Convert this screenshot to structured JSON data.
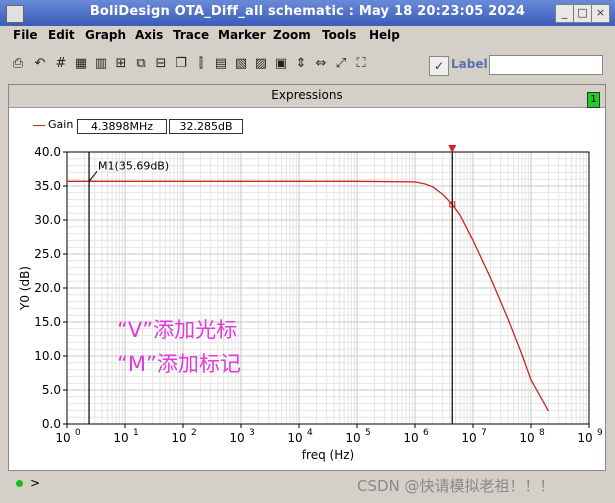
{
  "window": {
    "title": "BoliDesign OTA_Diff_all schematic : May 18 20:23:05 2024"
  },
  "menu": [
    "File",
    "Edit",
    "Graph",
    "Axis",
    "Trace",
    "Marker",
    "Zoom",
    "Tools",
    "Help"
  ],
  "toolbar": {
    "label_text": "Label",
    "label_value": ""
  },
  "panel": {
    "title": "Expressions",
    "badge": "1"
  },
  "legend": {
    "name": "Gain",
    "freq": "4.3898MHz",
    "value": "32.285dB"
  },
  "chart_data": {
    "type": "line",
    "xlabel": "freq (Hz)",
    "ylabel": "Y0 (dB)",
    "x_scale": "log",
    "xlim": [
      1,
      1000000000
    ],
    "ylim": [
      0,
      40
    ],
    "x_ticks": [
      "10^0",
      "10^1",
      "10^2",
      "10^3",
      "10^4",
      "10^5",
      "10^6",
      "10^7",
      "10^8",
      "10^9"
    ],
    "y_ticks": [
      "0.0",
      "5.0",
      "10.0",
      "15.0",
      "20.0",
      "25.0",
      "30.0",
      "35.0",
      "40.0"
    ],
    "grid": true,
    "series": [
      {
        "name": "Gain",
        "color": "#cc2222",
        "x": [
          1,
          10,
          100,
          1000,
          10000,
          100000,
          1000000,
          1500000,
          2000000,
          3000000,
          4389800,
          6000000,
          10000000,
          20000000,
          40000000,
          70000000,
          100000000,
          200000000
        ],
        "y": [
          35.69,
          35.69,
          35.69,
          35.69,
          35.69,
          35.69,
          35.6,
          35.3,
          34.9,
          33.8,
          32.285,
          30.7,
          27.0,
          21.5,
          15.5,
          10.2,
          6.5,
          1.9
        ]
      }
    ],
    "markers": [
      {
        "label": "M1(35.69dB)",
        "x": 2.4,
        "y": 35.69
      },
      {
        "label": "",
        "x": 4389800,
        "y": 32.285
      }
    ],
    "annotations": [
      "“V”添加光标",
      "“M”添加标记"
    ]
  },
  "status": {
    "prompt": ">"
  },
  "watermark": "CSDN @快请模拟老祖！！！"
}
